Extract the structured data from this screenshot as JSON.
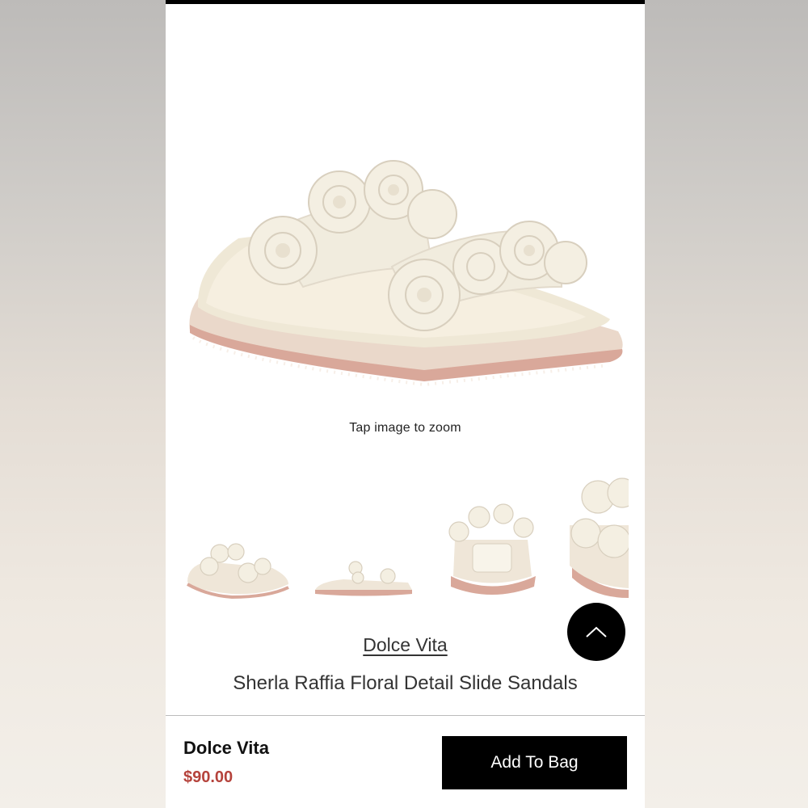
{
  "product": {
    "brand": "Dolce Vita",
    "name": "Sherla Raffia Floral Detail Slide Sandals",
    "price": "$90.00",
    "zoom_hint": "Tap image to zoom"
  },
  "actions": {
    "add_to_bag": "Add To Bag"
  },
  "gallery": {
    "views": [
      "front-angle",
      "side",
      "back",
      "detail"
    ]
  },
  "icons": {
    "scroll_top": "chevron-up-icon"
  },
  "colors": {
    "price": "#b5433c",
    "button": "#000000",
    "sandal_cream": "#f2eddf",
    "sole_pink": "#d9a89a"
  }
}
